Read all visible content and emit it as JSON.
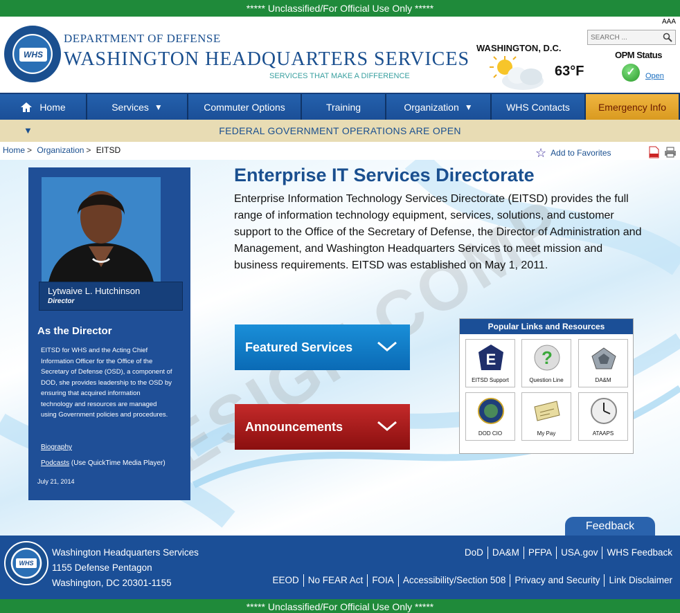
{
  "classification": "***** Unclassified/For Official Use Only *****",
  "header": {
    "department": "DEPARTMENT OF DEFENSE",
    "agency": "WASHINGTON HEADQUARTERS SERVICES",
    "tagline": "SERVICES THAT MAKE A DIFFERENCE",
    "seal_label": "WHS",
    "text_size": "AAA",
    "search_placeholder": "SEARCH ...",
    "weather": {
      "city": "WASHINGTON, D.C.",
      "temp": "63°F",
      "icon": "partly-cloudy-icon"
    },
    "opm": {
      "label": "OPM Status",
      "status": "Open",
      "color": "#2a9a2a"
    }
  },
  "nav": {
    "items": [
      {
        "label": "Home",
        "icon": "home-icon"
      },
      {
        "label": "Services",
        "dropdown": true
      },
      {
        "label": "Commuter Options"
      },
      {
        "label": "Training"
      },
      {
        "label": "Organization",
        "dropdown": true
      },
      {
        "label": "WHS Contacts"
      },
      {
        "label": "Emergency Info"
      }
    ]
  },
  "status_bar": {
    "message": "FEDERAL GOVERNMENT OPERATIONS ARE OPEN"
  },
  "breadcrumb": {
    "items": [
      "Home",
      "Organization",
      "EITSD"
    ]
  },
  "favorites_label": "Add to Favorites",
  "watermark": "DESIGN COMP",
  "director": {
    "name": "Lytwaive L. Hutchinson",
    "title": "Director",
    "heading": "As the Director",
    "text": "EITSD for WHS and the Acting Chief Information Officer for the Office of the Secretary of Defense (OSD), a component of DOD, she provides leadership to the OSD by ensuring that acquired information technology and resources are managed using Government policies and procedures.",
    "biography": "Biography",
    "podcasts": "Podcasts",
    "podcasts_note": "(Use QuickTime Media Player)",
    "date": "July 21, 2014"
  },
  "main": {
    "title": "Enterprise IT Services Directorate",
    "intro": "Enterprise Information Technology Services Directorate (EITSD) provides the full range of information technology equipment, services, solutions, and customer support to the Office of the Secretary of Defense, the Director of Administration and Management, and Washington Headquarters Services to meet mission and business requirements. EITSD was established on May 1, 2011.",
    "featured": "Featured Services",
    "announcements": "Announcements"
  },
  "popular_links": {
    "title": "Popular Links and Resources",
    "tiles": [
      {
        "label": "EITSD Support",
        "icon": "eitsd-support-icon"
      },
      {
        "label": "Question Line",
        "icon": "question-icon"
      },
      {
        "label": "DA&M",
        "icon": "pentagon-icon"
      },
      {
        "label": "DOD CIO",
        "icon": "dod-cio-seal-icon"
      },
      {
        "label": "My Pay",
        "icon": "check-paper-icon"
      },
      {
        "label": "ATAAPS",
        "icon": "clock-icon"
      }
    ]
  },
  "feedback": "Feedback",
  "footer": {
    "address": [
      "Washington Headquarters Services",
      "1155 Defense Pentagon",
      "Washington, DC 20301-1155"
    ],
    "links_row1": [
      "DoD",
      "DA&M",
      "PFPA",
      "USA.gov",
      "WHS Feedback"
    ],
    "links_row2": [
      "EEOD",
      "No FEAR Act",
      "FOIA",
      "Accessibility/Section 508",
      "Privacy and Security",
      "Link Disclaimer"
    ]
  },
  "colors": {
    "brand_blue": "#1b4f97",
    "banner_green": "#1f8a3a",
    "emergency": "#e0a530",
    "announcement_red": "#a81c1c",
    "featured_blue": "#0f7bc6"
  }
}
